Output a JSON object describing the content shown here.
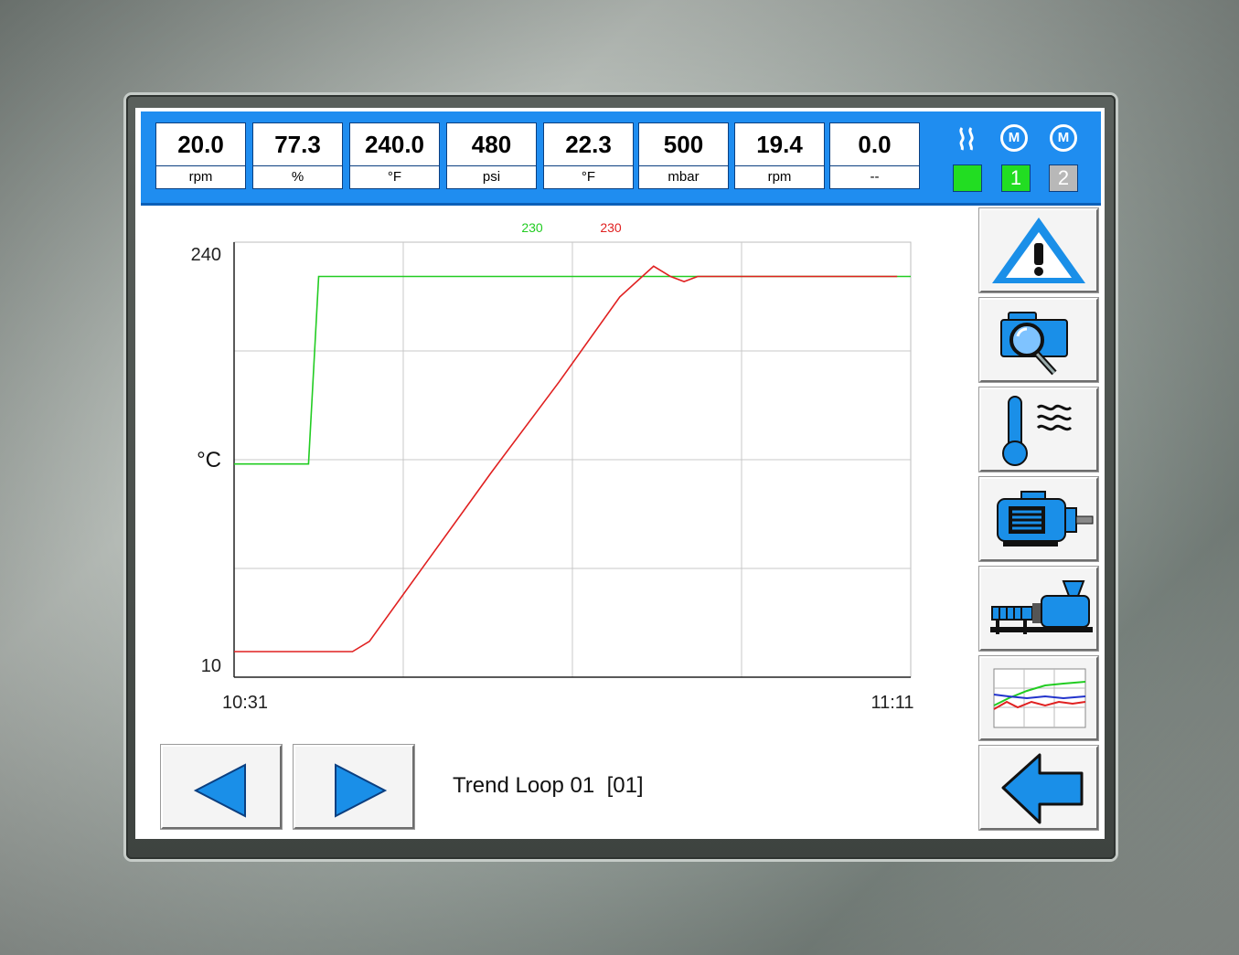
{
  "readouts": [
    {
      "value": "20.0",
      "unit": "rpm"
    },
    {
      "value": "77.3",
      "unit": "%"
    },
    {
      "value": "240.0",
      "unit": "°F"
    },
    {
      "value": "480",
      "unit": "psi"
    },
    {
      "value": "22.3",
      "unit": "°F"
    },
    {
      "value": "500",
      "unit": "mbar"
    },
    {
      "value": "19.4",
      "unit": "rpm"
    },
    {
      "value": "0.0",
      "unit": "--"
    }
  ],
  "status": {
    "heater_icon": "heat-waves-icon",
    "motor1_label": "M",
    "motor2_label": "M",
    "ind_heater_color": "#22dd22",
    "ind_motor1": "1",
    "ind_motor1_color": "#22dd22",
    "ind_motor2": "2",
    "ind_motor2_color": "#b8b8b8"
  },
  "chart_data": {
    "type": "line",
    "y_unit_label": "°C",
    "ylim": [
      10,
      240
    ],
    "y_ticks": [
      "240",
      "10"
    ],
    "x_start_label": "10:31",
    "x_end_label": "11:11",
    "grid": true,
    "legend_values": [
      {
        "text": "230",
        "color": "#22cc22"
      },
      {
        "text": "230",
        "color": "#e02020"
      }
    ],
    "series": [
      {
        "color": "#22cc22",
        "points": [
          [
            0,
            120
          ],
          [
            0.11,
            120
          ],
          [
            0.125,
            230
          ],
          [
            1.0,
            230
          ]
        ]
      },
      {
        "color": "#e02020",
        "points": [
          [
            0,
            10
          ],
          [
            0.175,
            10
          ],
          [
            0.2,
            16
          ],
          [
            0.28,
            60
          ],
          [
            0.38,
            115
          ],
          [
            0.48,
            168
          ],
          [
            0.57,
            218
          ],
          [
            0.62,
            236
          ],
          [
            0.645,
            230
          ],
          [
            0.665,
            227
          ],
          [
            0.685,
            230
          ],
          [
            0.98,
            230
          ]
        ]
      }
    ]
  },
  "side_buttons": [
    {
      "icon": "alarm-warning-icon"
    },
    {
      "icon": "camera-magnifier-icon"
    },
    {
      "icon": "temperature-icon"
    },
    {
      "icon": "motor-icon"
    },
    {
      "icon": "extruder-machine-icon"
    },
    {
      "icon": "trend-chart-icon"
    },
    {
      "icon": "back-arrow-icon"
    }
  ],
  "footer": {
    "title": "Trend Loop 01  [01]",
    "prev_icon": "arrow-left-icon",
    "next_icon": "arrow-right-icon"
  },
  "colors": {
    "bar_blue": "#1f8df0",
    "icon_blue": "#1a8fe8"
  }
}
